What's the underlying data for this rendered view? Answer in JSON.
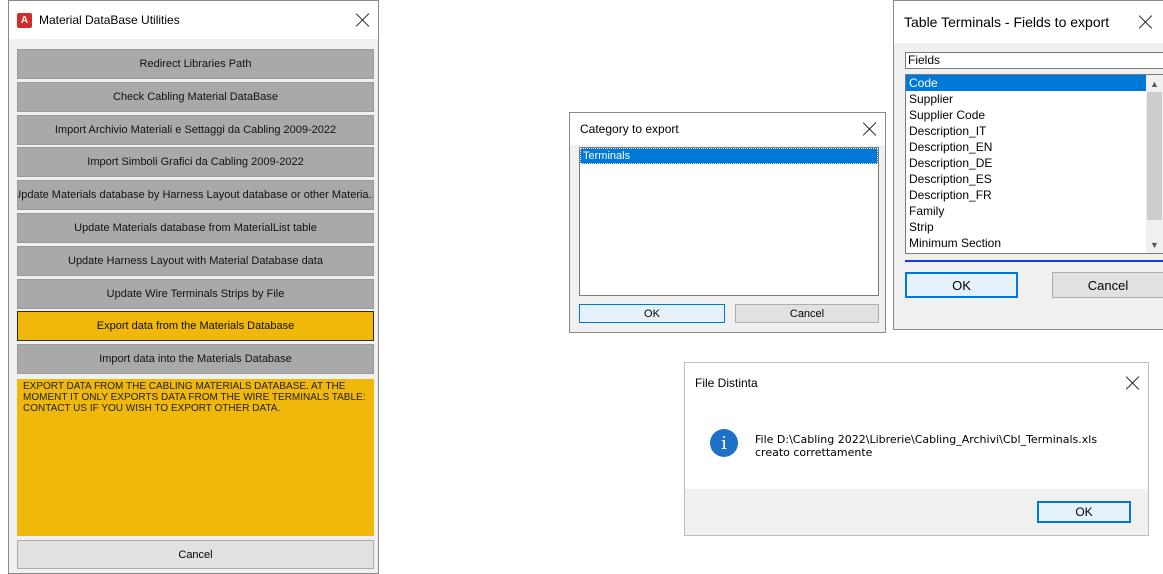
{
  "main_window": {
    "logo_letter": "A",
    "title": "Material DataBase Utilities",
    "buttons": [
      "Redirect Libraries Path",
      "Check Cabling Material DataBase",
      "Import Archivio Materiali e Settaggi da Cabling 2009-2022",
      "Import Simboli Grafici da Cabling 2009-2022",
      "Update Materials database by Harness Layout database or other Materia...",
      "Update Materials database from MaterialList table",
      "Update Harness Layout with Material Database data",
      "Update Wire Terminals Strips by File",
      "Export data from the Materials Database",
      "Import data into the Materials Database"
    ],
    "active_button_index": 8,
    "info_text": "EXPORT DATA FROM THE CABLING MATERIALS DATABASE. AT THE MOMENT IT ONLY EXPORTS DATA FROM THE WIRE TERMINALS TABLE: CONTACT US IF YOU WISH TO EXPORT OTHER DATA.",
    "cancel_label": "Cancel",
    "accent_color": "#efb80b"
  },
  "category_window": {
    "title": "Category to export",
    "items": [
      "Terminals"
    ],
    "ok_label": "OK",
    "cancel_label": "Cancel"
  },
  "fields_window": {
    "title": "Table Terminals - Fields to export",
    "input_value": "Fields",
    "items": [
      "Code",
      "Supplier",
      "Supplier Code",
      "Description_IT",
      "Description_EN",
      "Description_DE",
      "Description_ES",
      "Description_FR",
      "Family",
      "Strip",
      "Minimum Section"
    ],
    "selected_index": 0,
    "ok_label": "OK",
    "cancel_label": "Cancel"
  },
  "file_window": {
    "title": "File Distinta",
    "message_line1": "File D:\\Cabling 2022\\Librerie\\Cabling_Archivi\\Cbl_Terminals.xls",
    "message_line2": "creato correttamente",
    "ok_label": "OK",
    "icon": "info-icon"
  }
}
